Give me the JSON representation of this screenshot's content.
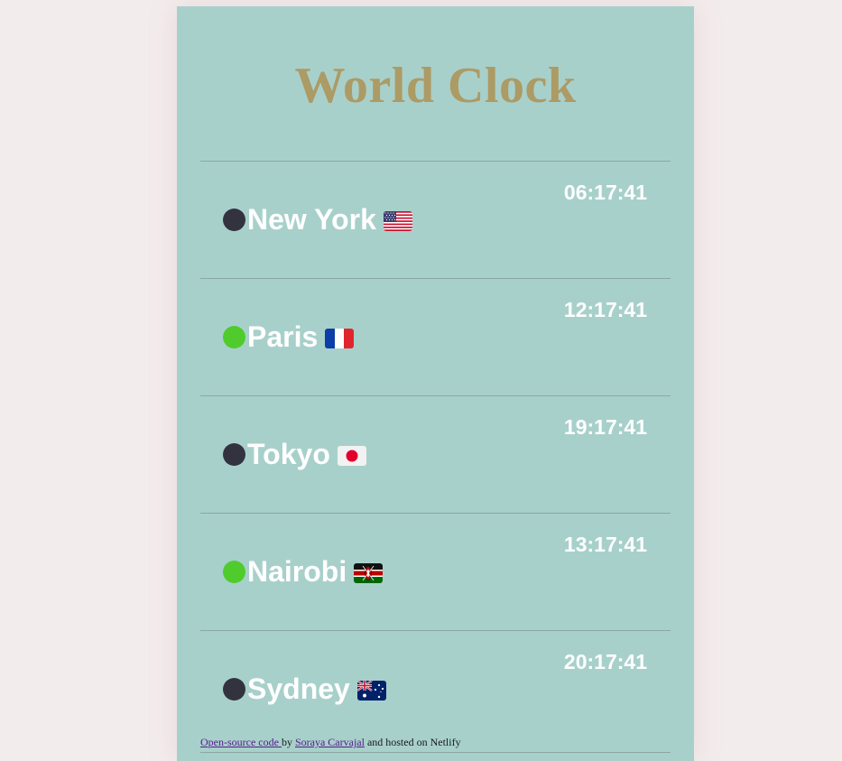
{
  "title": "World Clock",
  "colors": {
    "page_background": "#f3eced",
    "card_background": "#a8d0cb",
    "title": "#ac9b65",
    "status_day": "#4fcc2c",
    "status_night": "#33333f"
  },
  "cities": [
    {
      "name": "New York",
      "time": "06:17:41",
      "status": "night",
      "flag_icon": "us-flag-icon"
    },
    {
      "name": "Paris",
      "time": "12:17:41",
      "status": "day",
      "flag_icon": "france-flag-icon"
    },
    {
      "name": "Tokyo",
      "time": "19:17:41",
      "status": "night",
      "flag_icon": "japan-flag-icon"
    },
    {
      "name": "Nairobi",
      "time": "13:17:41",
      "status": "day",
      "flag_icon": "kenya-flag-icon"
    },
    {
      "name": "Sydney",
      "time": "20:17:41",
      "status": "night",
      "flag_icon": "australia-flag-icon"
    }
  ],
  "footer": {
    "source_link": "Open-source code ",
    "by_text": " by ",
    "author_link": "Soraya Carvajal",
    "hosted_text": " and hosted on Netlify"
  }
}
